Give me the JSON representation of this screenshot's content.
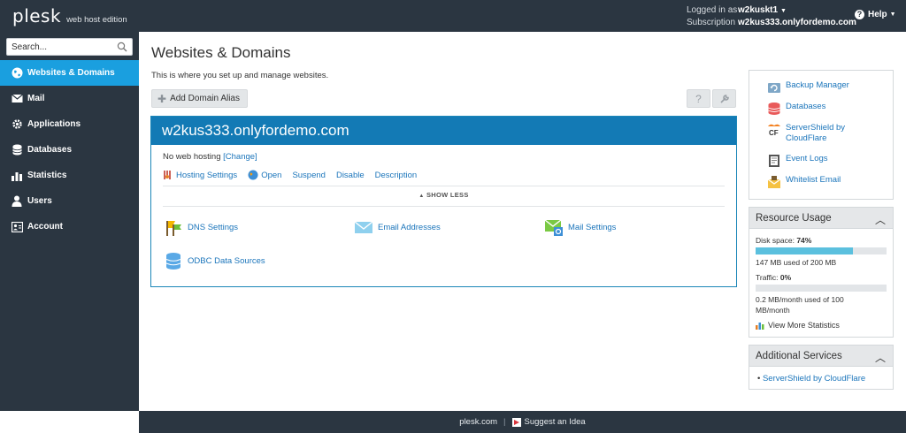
{
  "header": {
    "brand": "plesk",
    "edition": "web host edition",
    "logged_in_label": "Logged in as",
    "logged_in_user": "w2kuskt1",
    "subscription_label": "Subscription",
    "subscription_value": "w2kus333.onlyfordemo.com",
    "help_label": "Help"
  },
  "sidebar": {
    "search_placeholder": "Search...",
    "items": [
      {
        "label": "Websites & Domains",
        "icon": "globe-icon",
        "active": true
      },
      {
        "label": "Mail",
        "icon": "envelope-icon"
      },
      {
        "label": "Applications",
        "icon": "gear-icon"
      },
      {
        "label": "Databases",
        "icon": "database-icon"
      },
      {
        "label": "Statistics",
        "icon": "bar-chart-icon"
      },
      {
        "label": "Users",
        "icon": "user-icon"
      },
      {
        "label": "Account",
        "icon": "account-icon"
      }
    ]
  },
  "main": {
    "title": "Websites & Domains",
    "subtitle": "This is where you set up and manage websites.",
    "add_alias_label": "Add Domain Alias",
    "domain": {
      "name": "w2kus333.onlyfordemo.com",
      "hosting_status": "No web hosting",
      "change_label": "[Change]",
      "actions": [
        "Hosting Settings",
        "Open",
        "Suspend",
        "Disable",
        "Description"
      ],
      "show_less": "SHOW LESS",
      "tools": [
        {
          "label": "DNS Settings",
          "icon": "dns-flags-icon"
        },
        {
          "label": "Email Addresses",
          "icon": "email-envelope-icon"
        },
        {
          "label": "Mail Settings",
          "icon": "mail-settings-icon"
        },
        {
          "label": "ODBC Data Sources",
          "icon": "odbc-icon"
        }
      ]
    }
  },
  "quick_links": [
    {
      "label": "Backup Manager",
      "icon": "backup-icon"
    },
    {
      "label": "Databases",
      "icon": "database-stack-icon"
    },
    {
      "label": "ServerShield by CloudFlare",
      "icon": "cloudflare-icon"
    },
    {
      "label": "Event Logs",
      "icon": "event-logs-icon"
    },
    {
      "label": "Whitelist Email",
      "icon": "whitelist-icon"
    }
  ],
  "resource_usage": {
    "title": "Resource Usage",
    "disk_label": "Disk space:",
    "disk_percent": "74%",
    "disk_fraction": 0.74,
    "disk_detail": "147 MB used of 200 MB",
    "traffic_label": "Traffic:",
    "traffic_percent": "0%",
    "traffic_fraction": 0,
    "traffic_detail_1": "0.2 MB/month used of 100",
    "traffic_detail_2": "MB/month",
    "more_stats": "View More Statistics"
  },
  "additional_services": {
    "title": "Additional Services",
    "item": "ServerShield by CloudFlare"
  },
  "footer": {
    "link": "plesk.com",
    "suggest": "Suggest an Idea"
  },
  "colors": {
    "dark": "#2b3641",
    "accent": "#1a9fdf",
    "domain_header": "#137ab5",
    "link": "#1b75bb"
  }
}
